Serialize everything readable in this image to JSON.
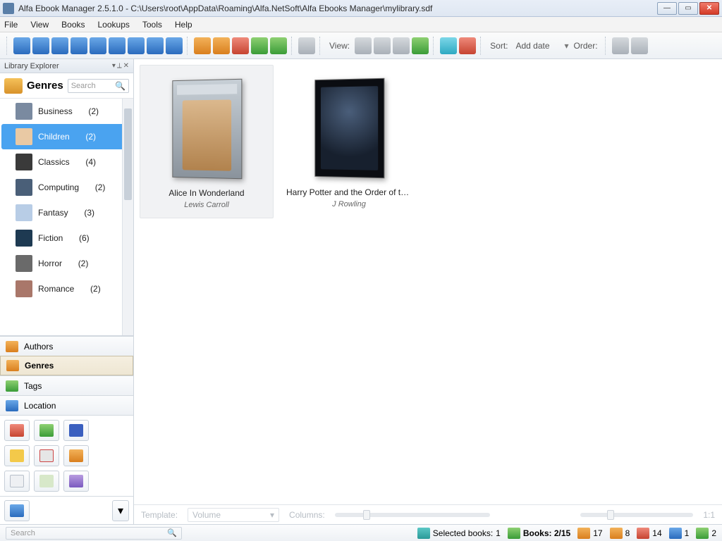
{
  "window": {
    "title": "Alfa Ebook Manager 2.5.1.0 - C:\\Users\\root\\AppData\\Roaming\\Alfa.NetSoft\\Alfa Ebooks Manager\\mylibrary.sdf"
  },
  "menubar": [
    "File",
    "View",
    "Books",
    "Lookups",
    "Tools",
    "Help"
  ],
  "toolbar": {
    "view_label": "View:",
    "sort_label": "Sort:",
    "sort_value": "Add date",
    "order_label": "Order:"
  },
  "explorer": {
    "header": "Library Explorer",
    "section": "Genres",
    "search_placeholder": "Search",
    "genres": [
      {
        "name": "Business",
        "count": "(2)"
      },
      {
        "name": "Children",
        "count": "(2)"
      },
      {
        "name": "Classics",
        "count": "(4)"
      },
      {
        "name": "Computing",
        "count": "(2)"
      },
      {
        "name": "Fantasy",
        "count": "(3)"
      },
      {
        "name": "Fiction",
        "count": "(6)"
      },
      {
        "name": "Horror",
        "count": "(2)"
      },
      {
        "name": "Romance",
        "count": "(2)"
      }
    ],
    "nav": [
      {
        "label": "Authors"
      },
      {
        "label": "Genres"
      },
      {
        "label": "Tags"
      },
      {
        "label": "Location"
      }
    ]
  },
  "books": [
    {
      "title": "Alice In Wonderland",
      "author": "Lewis Carroll"
    },
    {
      "title": "Harry Potter and the Order of the Ph...",
      "author": "J Rowling"
    }
  ],
  "template_bar": {
    "template_label": "Template:",
    "template_value": "Volume",
    "columns_label": "Columns:",
    "ratio": "1:1"
  },
  "status": {
    "search_placeholder": "Search",
    "selected_label": "Selected books:",
    "selected_count": "1",
    "books_label": "Books:",
    "books_value": "2/15",
    "counts": [
      "17",
      "8",
      "14",
      "1",
      "2"
    ]
  }
}
